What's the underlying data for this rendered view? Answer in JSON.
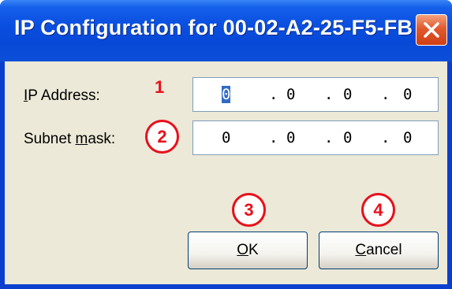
{
  "window": {
    "title": "IP Configuration for  00-02-A2-25-F5-FB"
  },
  "form": {
    "ip_label_u": "I",
    "ip_label_rest": "P Address:",
    "subnet_label_pre": "Subnet ",
    "subnet_label_u": "m",
    "subnet_label_rest": "ask:",
    "ip_address": [
      "0",
      "0",
      "0",
      "0"
    ],
    "subnet_mask": [
      "0",
      "0",
      "0",
      "0"
    ],
    "separator": "."
  },
  "buttons": {
    "ok_u": "O",
    "ok_rest": "K",
    "cancel_u": "C",
    "cancel_rest": "ancel"
  },
  "annotations": {
    "m1": "1",
    "m2": "2",
    "m3": "3",
    "m4": "4"
  },
  "icons": {
    "close": "close-icon"
  },
  "colors": {
    "titlebar": "#0a4fe0",
    "client_bg": "#ece9d8",
    "annotation": "#e8101a",
    "close_button": "#e2592e"
  }
}
